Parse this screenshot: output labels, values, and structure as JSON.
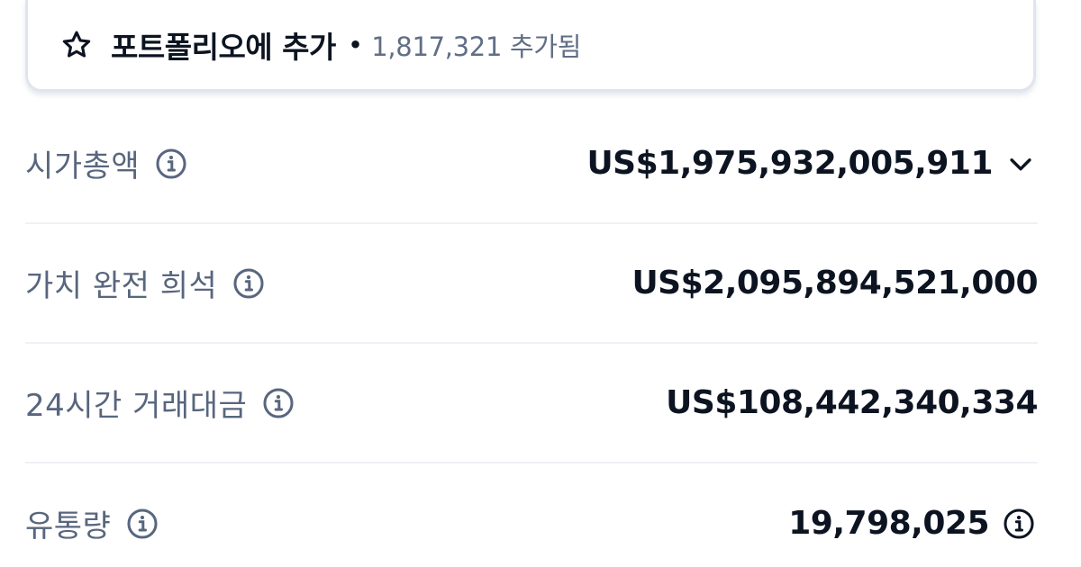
{
  "portfolio": {
    "title": "포트폴리오에 추가",
    "separator": "•",
    "count_text": "1,817,321 추가됨"
  },
  "stats": [
    {
      "label": "시가총액",
      "value": "US$1,975,932,005,911",
      "value_icon": "chevron-down-icon"
    },
    {
      "label": "가치 완전 희석",
      "value": "US$2,095,894,521,000"
    },
    {
      "label": "24시간 거래대금",
      "value": "US$108,442,340,334"
    },
    {
      "label": "유통량",
      "value": "19,798,025",
      "value_icon": "info-icon"
    }
  ],
  "colors": {
    "text_primary": "#0d1421",
    "text_secondary": "#58667e",
    "divider": "#eef1f5",
    "border": "#dfe5ee"
  }
}
